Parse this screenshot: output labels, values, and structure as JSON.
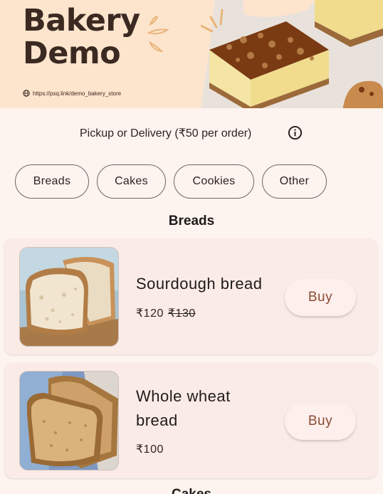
{
  "banner": {
    "title_line1": "Bakery",
    "title_line2": "Demo",
    "url": "https://psq.link/demo_bakery_store"
  },
  "delivery": {
    "text": "Pickup or Delivery (₹50 per order)",
    "icon": "info-icon"
  },
  "chips": [
    "Breads",
    "Cakes",
    "Cookies",
    "Other"
  ],
  "sections": [
    {
      "title": "Breads",
      "products": [
        {
          "name": "Sourdough bread",
          "price": "₹120",
          "old_price": "₹130",
          "buy_label": "Buy"
        },
        {
          "name_line1": "Whole wheat",
          "name_line2": "bread",
          "price": "₹100",
          "buy_label": "Buy"
        }
      ]
    },
    {
      "title": "Cakes"
    }
  ],
  "colors": {
    "background": "#fdf3ef",
    "banner": "#fde4cd",
    "card": "#fbebe6",
    "buy_text": "#8c4a36"
  }
}
